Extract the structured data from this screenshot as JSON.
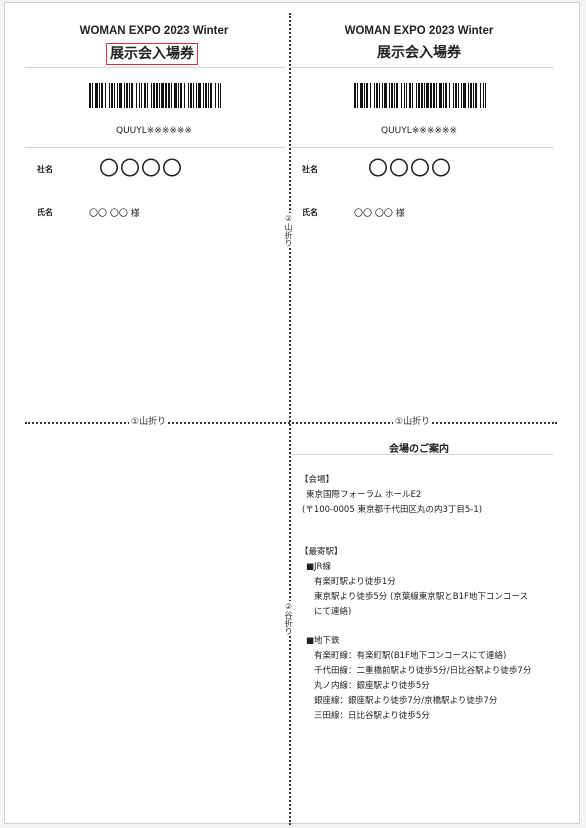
{
  "fold_labels": {
    "vertical_top": "②山折り",
    "vertical_bottom": "②谷折り",
    "horizontal_left": "①山折り",
    "horizontal_right": "①山折り"
  },
  "ticket": {
    "event": "WOMAN EXPO 2023 Winter",
    "title": "展示会入場券",
    "code": "QUUYL※※※※※※",
    "company_label": "社名",
    "company_value": "〇〇〇〇",
    "name_label": "氏名",
    "name_value": "〇〇 〇〇 様"
  },
  "venue_info": {
    "title": "会場のご案内",
    "venue_heading": "【会場】",
    "venue_name": "東京国際フォーラム ホールE2",
    "venue_address": "(〒100-0005 東京都千代田区丸の内3丁目5-1)",
    "station_heading": "【最寄駅】",
    "jr_heading": "■JR線",
    "jr_lines": [
      "有楽町駅より徒歩1分",
      "東京駅より徒歩5分 (京葉線東京駅とB1F地下コンコース",
      "にて連絡)"
    ],
    "subway_heading": "■地下鉄",
    "subway_lines": [
      "有楽町線：有楽町駅(B1F地下コンコースにて連絡)",
      "千代田線：二重橋前駅より徒歩5分/日比谷駅より徒歩7分",
      "丸ノ内線：銀座駅より徒歩5分",
      "銀座線：銀座駅より徒歩7分/京橋駅より徒歩7分",
      "三田線：日比谷駅より徒歩5分"
    ]
  },
  "colors": {
    "highlight_box": "#d9323a",
    "fold_line": "#333333"
  }
}
